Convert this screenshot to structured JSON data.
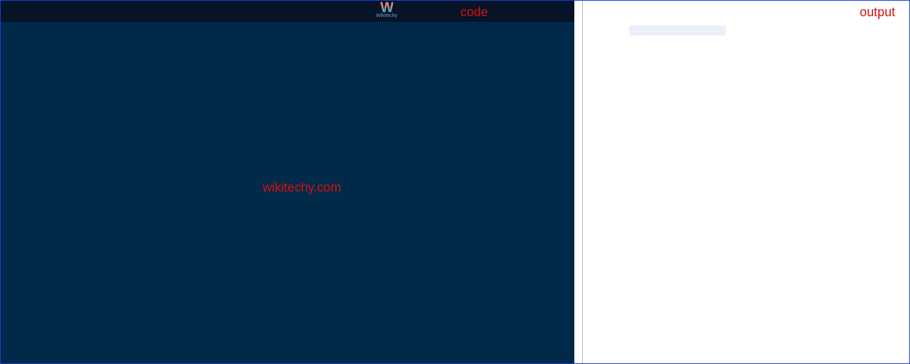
{
  "panels": {
    "code": {
      "label": "code",
      "watermark": "wikitechy.com"
    },
    "output": {
      "label": "output"
    }
  },
  "logo": {
    "mark": "W",
    "subtext": "Wikitechy"
  }
}
